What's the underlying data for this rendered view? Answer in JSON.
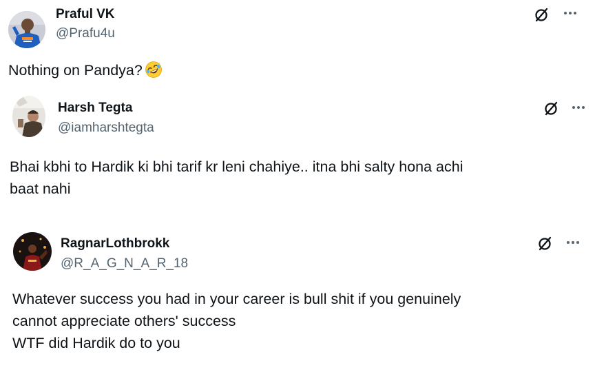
{
  "posts": [
    {
      "display_name": "Praful VK",
      "handle": "@Prafu4u",
      "text": "Nothing on Pandya?",
      "emoji": "rolling-on-floor-laughing-emoji"
    },
    {
      "display_name": "Harsh Tegta",
      "handle": "@iamharshtegta",
      "text_lines": [
        "Bhai kbhi to Hardik ki bhi tarif kr leni chahiye.. itna bhi salty hona achi",
        "baat nahi"
      ]
    },
    {
      "display_name": "RagnarLothbrokk",
      "handle": "@R_A_G_N_A_R_18",
      "text_lines": [
        "Whatever success you had in your career is bull shit if you genuinely",
        "cannot appreciate others' success",
        "WTF did Hardik do to you"
      ]
    }
  ],
  "icons": {
    "grok": "grok-icon",
    "more": "more-options-icon"
  },
  "colors": {
    "text": "#0f1419",
    "secondary": "#536471"
  }
}
